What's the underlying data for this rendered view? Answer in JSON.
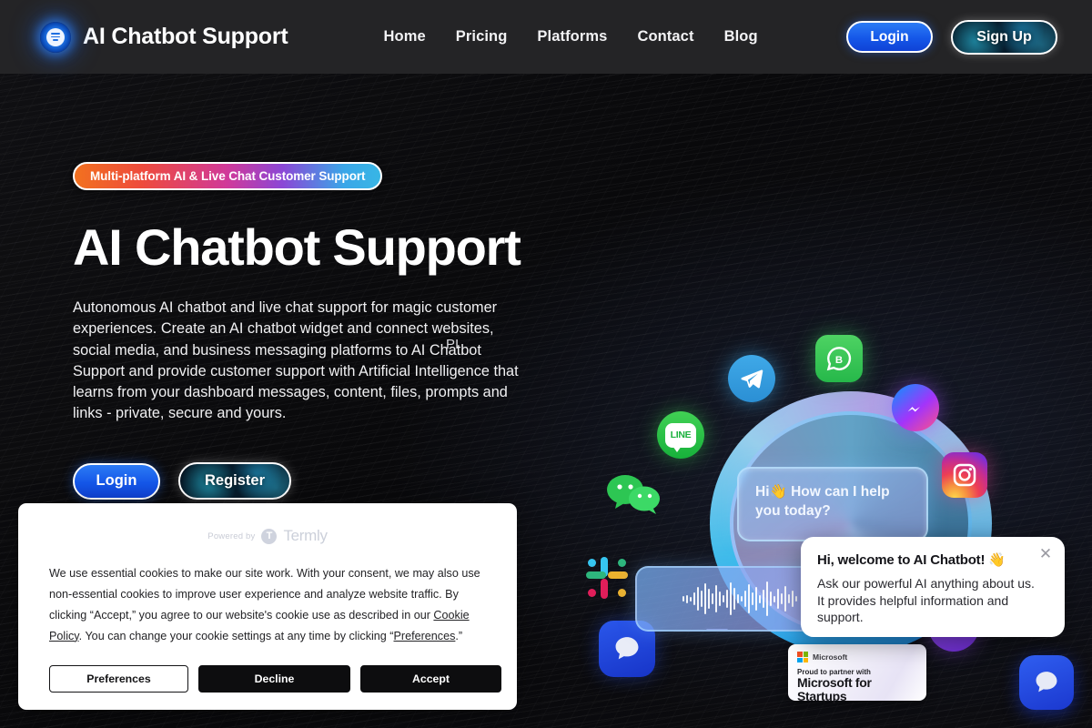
{
  "header": {
    "brand_name": "AI Chatbot Support",
    "logo_icon": "chatbot-logo-icon",
    "nav": [
      {
        "label": "Home"
      },
      {
        "label": "Pricing"
      },
      {
        "label": "Platforms"
      },
      {
        "label": "Contact"
      },
      {
        "label": "Blog"
      }
    ],
    "login_label": "Login",
    "signup_label": "Sign Up"
  },
  "hero": {
    "badge": "Multi-platform AI & Live Chat Customer Support",
    "title": "AI Chatbot Support",
    "description": "Autonomous AI chatbot and live chat support for magic customer experiences. Create an AI chatbot widget and connect websites, social media, and business messaging platforms to AI Chatbot Support and provide customer support with Artificial Intelligence that learns from your dashboard messages, content, files, prompts and links - private, secure and yours.",
    "login_label": "Login",
    "register_label": "Register",
    "subnote_partial": "PI"
  },
  "illustration": {
    "glass_bubble_text": "Hi👋 How can I help you today?",
    "icons": [
      {
        "name": "telegram-icon",
        "label": "Telegram"
      },
      {
        "name": "whatsapp-business-icon",
        "label": "WhatsApp Business"
      },
      {
        "name": "messenger-icon",
        "label": "Messenger"
      },
      {
        "name": "line-icon",
        "label": "LINE"
      },
      {
        "name": "wechat-icon",
        "label": "WeChat"
      },
      {
        "name": "instagram-icon",
        "label": "Instagram"
      },
      {
        "name": "slack-icon",
        "label": "Slack"
      },
      {
        "name": "viber-icon",
        "label": "Viber"
      },
      {
        "name": "chat-app-icon",
        "label": "Chat"
      }
    ],
    "microsoft_badge": {
      "brand": "Microsoft",
      "line1": "Proud to partner with",
      "line2": "Microsoft for Startups"
    }
  },
  "chat_popup": {
    "title": "Hi, welcome to AI Chatbot! 👋",
    "body": "Ask our powerful AI anything about us. It provides helpful information and support.",
    "close_icon": "close-icon",
    "launcher_icon": "chat-bubble-icon"
  },
  "cookie_banner": {
    "powered_by": "Powered by",
    "provider": "Termly",
    "text_part1": "We use essential cookies to make our site work. With your consent, we may also use non-essential cookies to improve user experience and analyze website traffic. By clicking “Accept,” you agree to our website's cookie use as described in our ",
    "link_cookie_policy": "Cookie Policy",
    "text_part2": ". You can change your cookie settings at any time by clicking “",
    "link_preferences": "Preferences",
    "text_part3": ".”",
    "preferences_label": "Preferences",
    "decline_label": "Decline",
    "accept_label": "Accept"
  },
  "colors": {
    "header_bg": "#242426",
    "page_bg": "#0a0a0c",
    "primary_blue": "#1557e8",
    "accent_cyan": "#32dcff",
    "badge_gradient_start": "#f2711f",
    "badge_gradient_end": "#38b6e5",
    "cookie_dark": "#0d0d0f"
  }
}
